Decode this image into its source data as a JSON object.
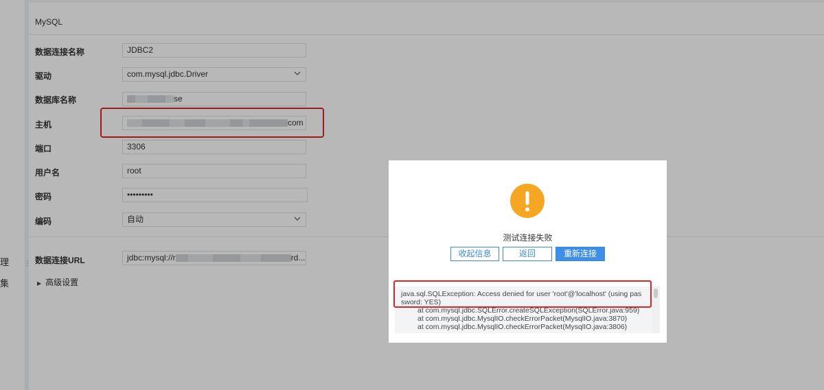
{
  "sidebar": {
    "items": [
      {
        "label": "理"
      },
      {
        "label": "集"
      }
    ]
  },
  "form": {
    "section_title": "MySQL",
    "fields": {
      "name": {
        "label": "数据连接名称",
        "value": "JDBC2"
      },
      "driver": {
        "label": "驱动",
        "value": "com.mysql.jdbc.Driver"
      },
      "database": {
        "label": "数据库名称",
        "value_suffix": "se"
      },
      "host": {
        "label": "主机",
        "value_suffix": "com"
      },
      "port": {
        "label": "端口",
        "value": "3306"
      },
      "username": {
        "label": "用户名",
        "value": "root"
      },
      "password": {
        "label": "密码",
        "value": "•••••••••"
      },
      "encoding": {
        "label": "编码",
        "value": "自动"
      },
      "url": {
        "label": "数据连接URL",
        "value_prefix": "jdbc:mysql://r",
        "value_suffix": "rd..."
      }
    },
    "advanced_label": "高级设置"
  },
  "dialog": {
    "icon": "warning-icon",
    "icon_color": "#f5a623",
    "message": "测试连接失败",
    "buttons": {
      "collapse": "收起信息",
      "back": "返回",
      "reconnect": "重新连接"
    },
    "log": {
      "lines": [
        "java.sql.SQLException: Access denied for user 'root'@'localhost' (using pas",
        "sword: YES)",
        "at com.mysql.jdbc.SQLError.createSQLException(SQLError.java:959)",
        "at com.mysql.jdbc.MysqlIO.checkErrorPacket(MysqlIO.java:3870)",
        "at com.mysql.jdbc.MysqlIO.checkErrorPacket(MysqlIO.java:3806)"
      ]
    }
  },
  "colors": {
    "accent": "#3d8ee8",
    "highlight": "#e02424"
  }
}
